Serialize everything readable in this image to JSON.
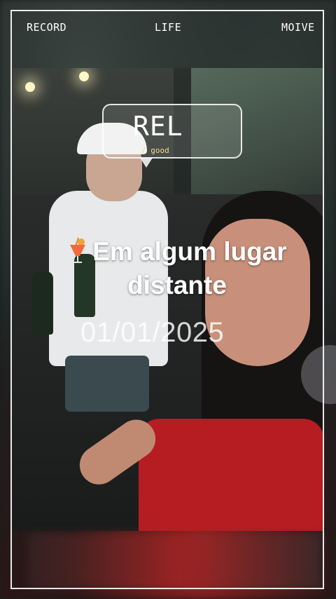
{
  "header": {
    "left_label": "RECORD",
    "center_label": "LIFE",
    "right_label": "MOIVE"
  },
  "bubble": {
    "title": "REL",
    "subtitle": "/ good"
  },
  "caption": {
    "emoji_icon": "tropical-drink-icon",
    "line1": "Em algum lugar",
    "line2": "distante",
    "date": "01/01/2025"
  },
  "colors": {
    "frame": "#ffffff",
    "bubble_subtitle": "#f4d98a",
    "dress_red": "#b51d22"
  }
}
